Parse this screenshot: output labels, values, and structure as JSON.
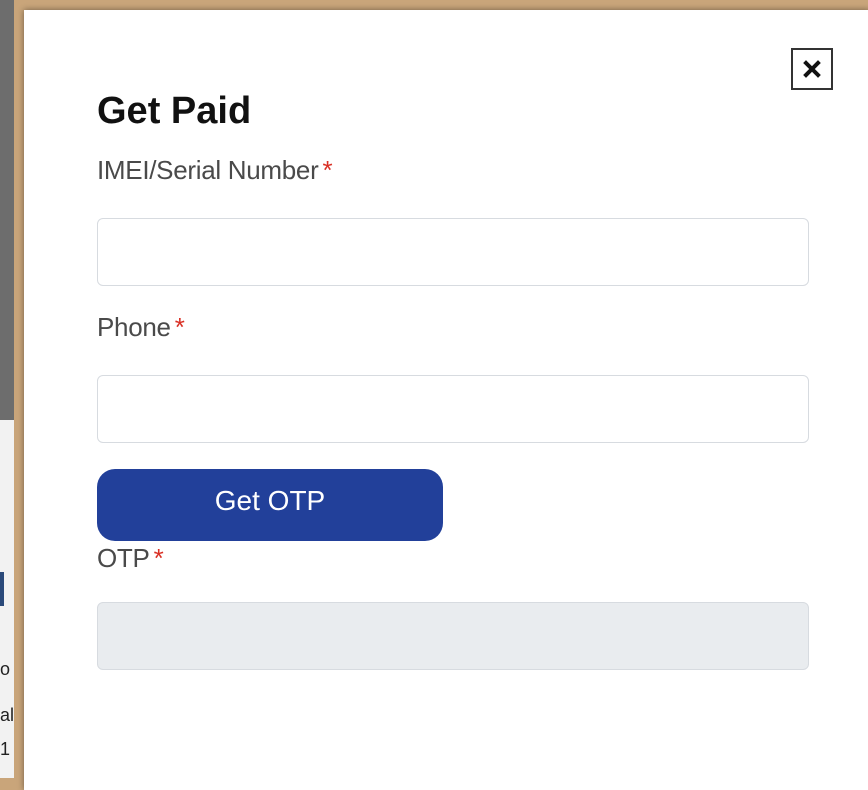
{
  "modal": {
    "title": "Get Paid",
    "close_icon": "close-icon"
  },
  "fields": {
    "imei": {
      "label": "IMEI/Serial Number",
      "required_mark": "*",
      "value": "",
      "placeholder": ""
    },
    "phone": {
      "label": "Phone",
      "required_mark": "*",
      "value": "",
      "placeholder": ""
    },
    "otp": {
      "label": "OTP",
      "required_mark": "*",
      "value": "",
      "placeholder": ""
    }
  },
  "buttons": {
    "get_otp": "Get OTP"
  },
  "colors": {
    "accent": "#22409a",
    "required": "#d93025",
    "disabled_input": "#e9ecef",
    "backdrop": "#c9a57a"
  },
  "background": {
    "fragments": [
      "o",
      "al",
      "1"
    ]
  }
}
